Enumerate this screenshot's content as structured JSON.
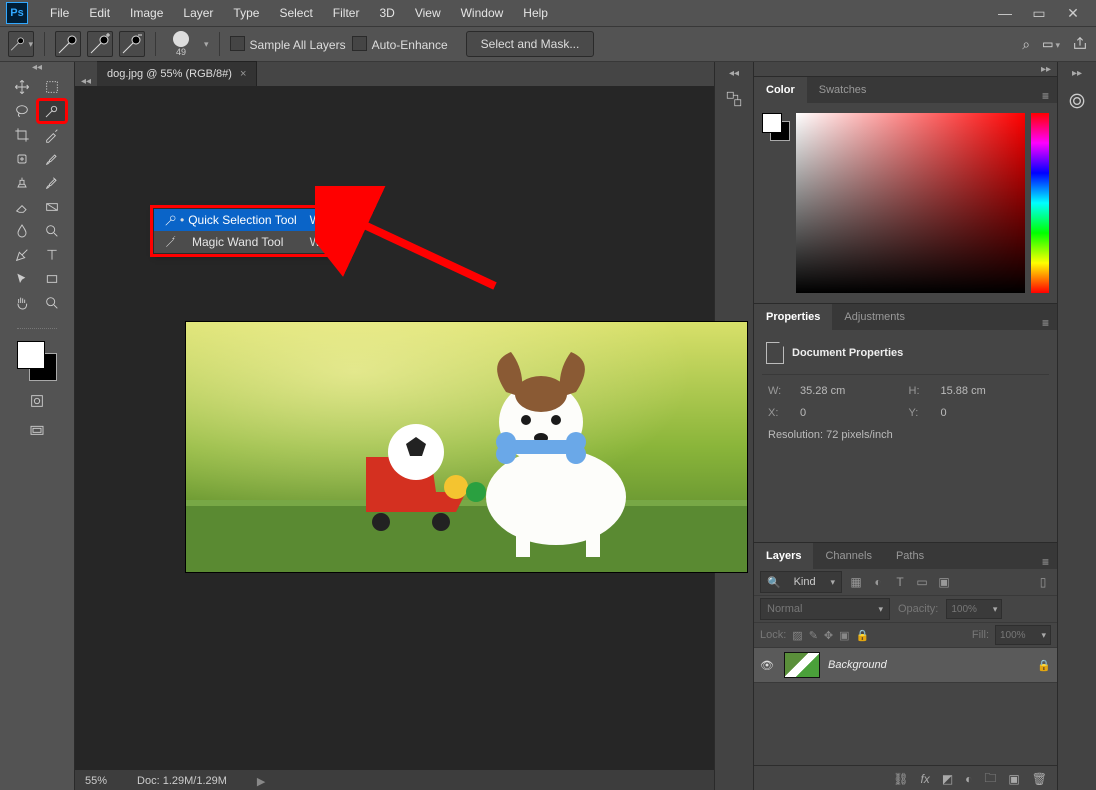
{
  "menubar": {
    "items": [
      "File",
      "Edit",
      "Image",
      "Layer",
      "Type",
      "Select",
      "Filter",
      "3D",
      "View",
      "Window",
      "Help"
    ]
  },
  "optionsbar": {
    "brush_size": "49",
    "sample_all_layers": "Sample All Layers",
    "auto_enhance": "Auto-Enhance",
    "select_and_mask": "Select and Mask..."
  },
  "document": {
    "tab_title": "dog.jpg @ 55% (RGB/8#)"
  },
  "flyout": {
    "items": [
      {
        "label": "Quick Selection Tool",
        "shortcut": "W",
        "selected": true
      },
      {
        "label": "Magic Wand Tool",
        "shortcut": "W",
        "selected": false
      }
    ]
  },
  "statusbar": {
    "zoom": "55%",
    "doc": "Doc: 1.29M/1.29M"
  },
  "panels": {
    "color_tab": "Color",
    "swatches_tab": "Swatches",
    "properties_tab": "Properties",
    "adjustments_tab": "Adjustments",
    "layers_tab": "Layers",
    "channels_tab": "Channels",
    "paths_tab": "Paths"
  },
  "properties": {
    "title": "Document Properties",
    "w_label": "W:",
    "w_value": "35.28 cm",
    "h_label": "H:",
    "h_value": "15.88 cm",
    "x_label": "X:",
    "x_value": "0",
    "y_label": "Y:",
    "y_value": "0",
    "resolution": "Resolution: 72 pixels/inch"
  },
  "layers": {
    "kind_label": "Kind",
    "blend_mode": "Normal",
    "opacity_label": "Opacity:",
    "opacity_value": "100%",
    "lock_label": "Lock:",
    "fill_label": "Fill:",
    "fill_value": "100%",
    "layer0_name": "Background",
    "search_placeholder": "Kind"
  }
}
